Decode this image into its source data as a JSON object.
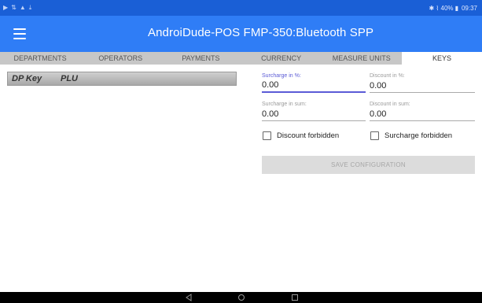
{
  "status_bar": {
    "left_icons": [
      "media-play-icon",
      "signal-share-icon",
      "upload-icon",
      "download-icon"
    ],
    "right_text": "✱ ⌇ 40% ▮  09:37"
  },
  "app_bar": {
    "title": "AndroiDude-POS   FMP-350:Bluetooth SPP"
  },
  "tabs": [
    {
      "label": "DEPARTMENTS",
      "active": false
    },
    {
      "label": "OPERATORS",
      "active": false
    },
    {
      "label": "PAYMENTS",
      "active": false
    },
    {
      "label": "CURRENCY",
      "active": false
    },
    {
      "label": "MEASURE UNITS",
      "active": false
    },
    {
      "label": "KEYS",
      "active": true
    }
  ],
  "plu_table": {
    "col_dp_key": "DP Key",
    "col_plu": "PLU"
  },
  "form": {
    "surcharge_percent": {
      "label": "Surcharge in %:",
      "value": "0.00"
    },
    "discount_percent": {
      "label": "Discount in %:",
      "value": "0.00"
    },
    "surcharge_sum": {
      "label": "Surcharge in sum:",
      "value": "0.00"
    },
    "discount_sum": {
      "label": "Discount in sum:",
      "value": "0.00"
    },
    "discount_forbidden": {
      "label": "Discount forbidden",
      "checked": false
    },
    "surcharge_forbidden": {
      "label": "Surcharge forbidden",
      "checked": false
    },
    "save_label": "SAVE CONFIGURATION"
  },
  "colors": {
    "status_bar": "#1a5fd6",
    "app_bar": "#2f7df6",
    "tab_strip": "#c7c7c7",
    "focus_accent": "#5b5bd6"
  }
}
